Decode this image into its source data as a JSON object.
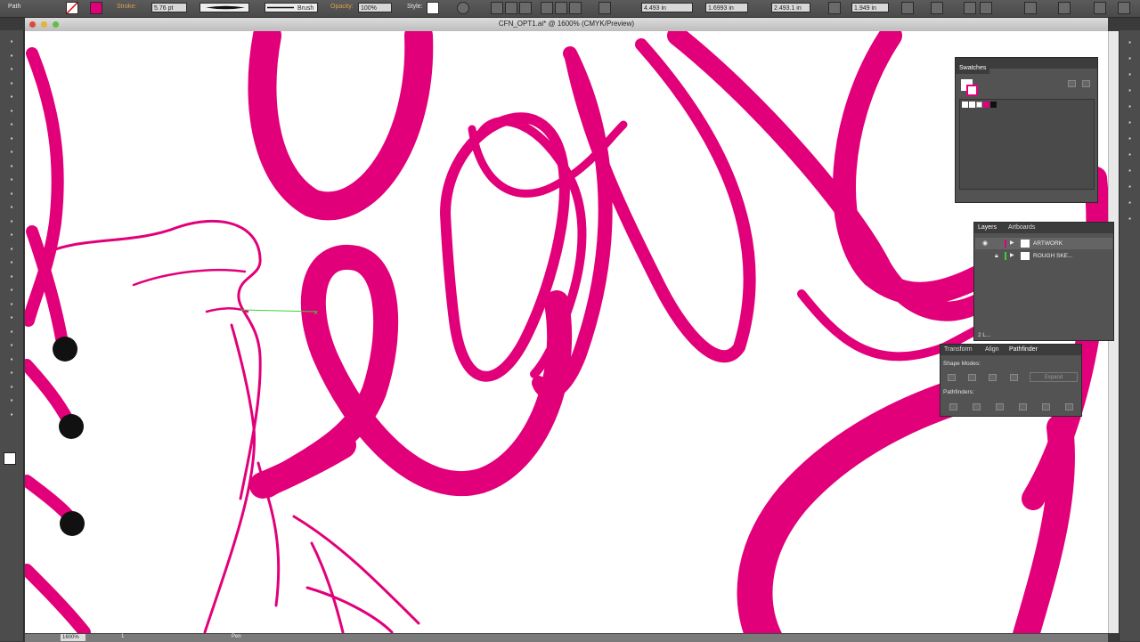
{
  "control_bar": {
    "selection_type": "Path",
    "stroke_label": "Stroke:",
    "stroke_value": "5.76 pt",
    "brush_label": "Brush",
    "opacity_label": "Opacity:",
    "opacity_value": "100%",
    "style_label": "Style:",
    "x_value": "4.493 in",
    "y_value": "1.6993 in",
    "w_value": "2.493.1 in",
    "h_value": "1.949 in"
  },
  "document": {
    "title": "CFN_OPT1.ai* @ 1600% (CMYK/Preview)",
    "zoom": "1600%",
    "page": "1",
    "status": "Pen"
  },
  "swatches_panel": {
    "title": "Swatches"
  },
  "layers_panel": {
    "tabs": [
      "Layers",
      "Artboards"
    ],
    "layers": [
      {
        "name": "ARTWORK",
        "color": "#e2007a"
      },
      {
        "name": "ROUGH SKE...",
        "color": "#39d339"
      }
    ],
    "count_label": "2 L..."
  },
  "pathfinder_panel": {
    "tabs": [
      "Transform",
      "Align",
      "Pathfinder"
    ],
    "shape_modes_label": "Shape Modes:",
    "expand_label": "Expand",
    "pathfinders_label": "Pathfinders:"
  },
  "colors": {
    "artwork": "#e2007a",
    "guide": "#39d339",
    "ui_dark": "#4c4c4c"
  },
  "icons": {
    "tools": [
      "selection-icon",
      "direct-selection-icon",
      "magic-wand-icon",
      "lasso-icon",
      "pen-icon",
      "type-icon",
      "line-icon",
      "rectangle-icon",
      "paintbrush-icon",
      "pencil-icon",
      "blob-brush-icon",
      "eraser-icon",
      "rotate-icon",
      "scale-icon",
      "warp-icon",
      "free-transform-icon",
      "shape-builder-icon",
      "perspective-icon",
      "mesh-icon",
      "gradient-icon",
      "eyedropper-icon",
      "blend-icon",
      "symbol-sprayer-icon",
      "graph-icon",
      "artboard-icon",
      "slice-icon",
      "hand-icon",
      "zoom-icon"
    ]
  }
}
